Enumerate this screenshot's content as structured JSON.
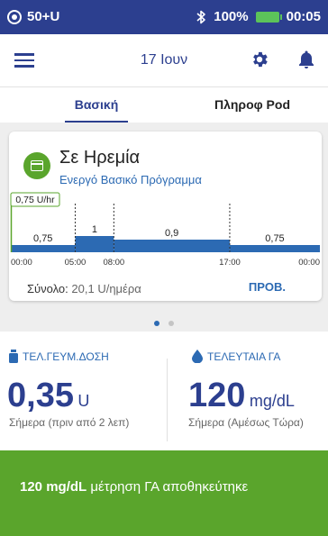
{
  "status_bar": {
    "carrier": "50+U",
    "bluetooth": "bluetooth-icon",
    "battery": "100%",
    "time": "00:05"
  },
  "app_bar": {
    "date": "17 Ιουν"
  },
  "tabs": [
    {
      "label": "Βασική",
      "active": true
    },
    {
      "label": "Πληροφ Pod",
      "active": false
    }
  ],
  "basal_card": {
    "status_title": "Σε Ηρεμία",
    "program_name": "Ενεργό Βασικό Πρόγραμμα",
    "current_rate": "0,75 U/hr",
    "total_label": "Σύνολο:",
    "total_value": "20,1 U/ημέρα",
    "view_button": "ΠΡΟΒ."
  },
  "chart_data": {
    "type": "area",
    "segments": [
      {
        "start": "00:00",
        "end": "05:00",
        "rate": 0.75,
        "label": "0,75"
      },
      {
        "start": "05:00",
        "end": "08:00",
        "rate": 1.0,
        "label": "1"
      },
      {
        "start": "08:00",
        "end": "17:00",
        "rate": 0.9,
        "label": "0,9"
      },
      {
        "start": "17:00",
        "end": "00:00",
        "rate": 0.75,
        "label": "0,75"
      }
    ],
    "x_ticks": [
      "00:00",
      "05:00",
      "08:00",
      "17:00",
      "00:00"
    ],
    "colors": {
      "bar": "#2c6ab3",
      "highlight": "#5aa52c"
    }
  },
  "pager": {
    "pages": 2,
    "active": 0
  },
  "stats": {
    "last_bolus": {
      "title": "ΤΕΛ.ΓΕΥΜ.ΔΟΣΗ",
      "value": "0,35",
      "unit": "U",
      "note": "Σήμερα (πριν από 2 λεπ)"
    },
    "last_bg": {
      "title": "ΤΕΛΕΥΤΑΙΑ ΓΑ",
      "value": "120",
      "unit": "mg/dL",
      "note": "Σήμερα (Αμέσως Τώρα)"
    }
  },
  "toast": {
    "bold": "120 mg/dL",
    "message": " μέτρηση ΓΑ αποθηκεύτηκε"
  },
  "colors": {
    "primary": "#2c3f8f",
    "accent_blue": "#2c6ab3",
    "success_green": "#5aa52c",
    "status_bar": "#2c3f8f"
  }
}
